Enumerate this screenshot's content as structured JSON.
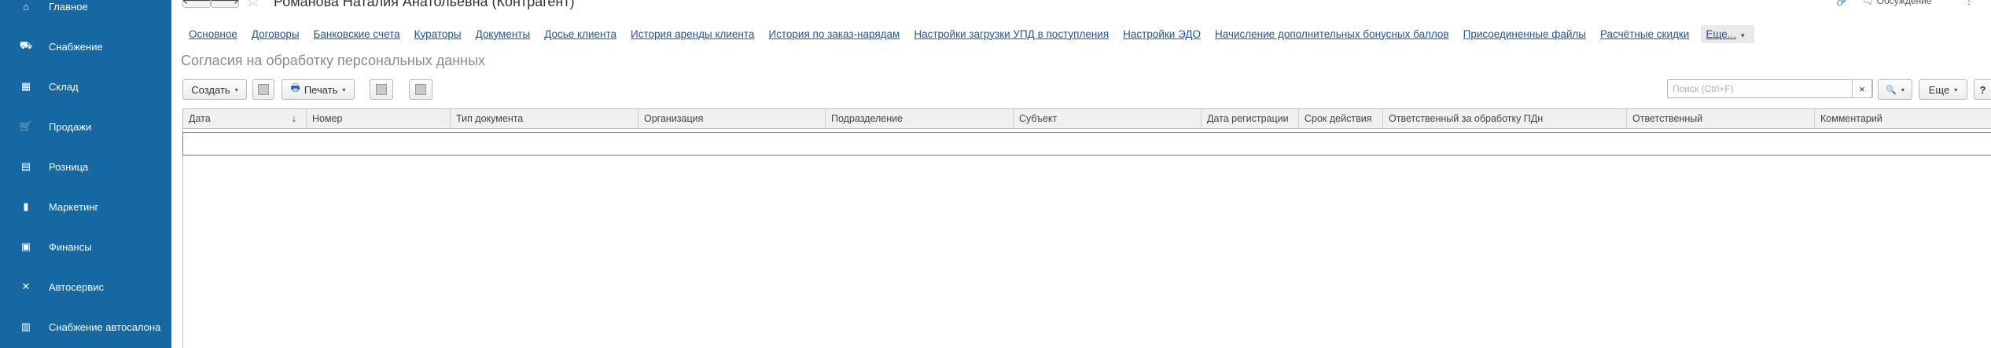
{
  "sidebar": {
    "items": [
      {
        "label": "Главное",
        "icon": "home-icon",
        "glyph": "⌂"
      },
      {
        "label": "Снабжение",
        "icon": "truck-icon",
        "glyph": "⛟"
      },
      {
        "label": "Склад",
        "icon": "warehouse-icon",
        "glyph": "▦"
      },
      {
        "label": "Продажи",
        "icon": "cart-icon",
        "glyph": "🛒"
      },
      {
        "label": "Розница",
        "icon": "register-icon",
        "glyph": "▤"
      },
      {
        "label": "Маркетинг",
        "icon": "bar-chart-icon",
        "glyph": "▮"
      },
      {
        "label": "Финансы",
        "icon": "wallet-icon",
        "glyph": "▣"
      },
      {
        "label": "Автосервис",
        "icon": "wrench-icon",
        "glyph": "✕"
      },
      {
        "label": "Снабжение автосалона",
        "icon": "clipboard-icon",
        "glyph": "▥"
      }
    ]
  },
  "header": {
    "back_glyph": "🡐",
    "forward_glyph": "🡒",
    "star_glyph": "☆",
    "title": "Романова Наталия Анатольевна (Контрагент)",
    "link_glyph": "🔗",
    "discussion_label": "Обсуждение",
    "discussion_glyph": "🗨",
    "menu_glyph": "⋮"
  },
  "tabs": {
    "items": [
      "Основное",
      "Договоры",
      "Банковские счета",
      "Кураторы",
      "Документы",
      "Досье клиента",
      "История аренды клиента",
      "История по заказ-нарядам",
      "Настройки загрузки УПД в поступления",
      "Настройки ЭДО",
      "Начисление дополнительных бонусных баллов",
      "Присоединенные файлы",
      "Расчётные скидки"
    ],
    "more_label": "Еще...",
    "more_caret": "▾"
  },
  "section_title": "Согласия на обработку персональных данных",
  "toolbar": {
    "create_label": "Создать",
    "print_label": "Печать",
    "print_glyph": "🖶",
    "caret": "▾",
    "search_placeholder": "Поиск (Ctrl+F)",
    "clear_glyph": "×",
    "search_glyph": "🔍",
    "more_label": "Еще",
    "help_label": "?"
  },
  "table": {
    "columns": [
      "Дата",
      "Номер",
      "Тип документа",
      "Организация",
      "Подразделение",
      "Субъект",
      "Дата регистрации",
      "Срок действия",
      "Ответственный за обработку ПДн",
      "Ответственный",
      "Комментарий"
    ],
    "sort_glyph": "↓"
  },
  "colors": {
    "sidebar_bg": "#1668a3",
    "link": "#1a56a5",
    "section_title": "#8c8c8c"
  }
}
